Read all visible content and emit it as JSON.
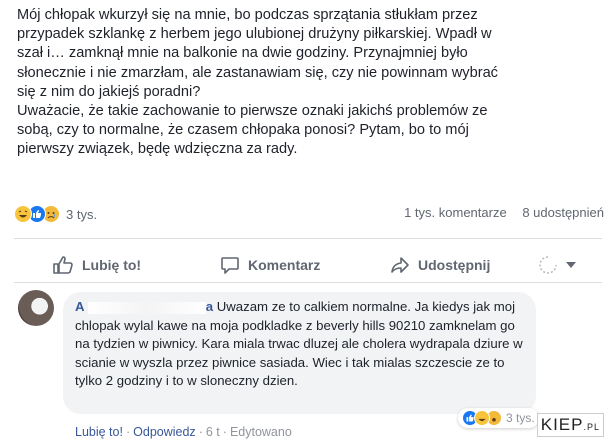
{
  "post": {
    "paragraphs": [
      "Mój chłopak wkurzył się na mnie, bo podczas sprzątania stłukłam przez\nprzypadek szklankę z herbem jego ulubionej drużyny piłkarskiej. Wpadł w\nszał i… zamknął mnie na balkonie na dwie godziny. Przynajmniej było\nsłonecznie i nie zmarzłam, ale zastanawiam się, czy nie powinnam wybrać\nsię z nim do jakiejś poradni?",
      "Uważacie, że takie zachowanie to pierwsze oznaki jakichś problemów ze\nsobą, czy to normalne, że czasem chłopaka ponosi? Pytam, bo to mój\npierwszy związek, będę wdzięczna za rady."
    ]
  },
  "stats": {
    "reactions_count": "3 tys.",
    "comments": "1 tys. komentarze",
    "shares": "8 udostępnień"
  },
  "actions": {
    "like": "Lubię to!",
    "comment": "Komentarz",
    "share": "Udostępnij"
  },
  "comment": {
    "author_visible": "A",
    "author_suffix": "a",
    "text": "Uwazam ze to calkiem normalne. Ja kiedys jak moj chlopak wylal kawe na moja podkladke z beverly hills 90210 zamknelam go na tydzien w piwnicy. Kara miala trwac dluzej ale cholera wydrapala dziure w scianie w wyszla przez piwnice sasiada. Wiec i tak mialas szczescie ze to tylko 2 godziny i to w sloneczny dzien.",
    "like": "Lubię to!",
    "reply": "Odpowiedz",
    "time": "6 t",
    "edited": "Edytowano",
    "reactions_count": "3 tys."
  },
  "watermark": {
    "main": "KIEP",
    "suffix": ".PL"
  },
  "colors": {
    "link": "#385898",
    "muted": "#606770",
    "like_blue": "#1877f2"
  }
}
